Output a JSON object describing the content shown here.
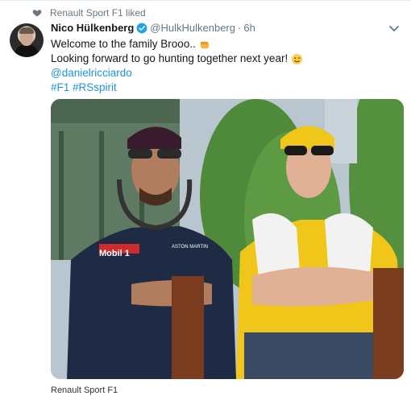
{
  "context": {
    "text": "Renault Sport F1 liked",
    "icon": "heart-icon"
  },
  "author": {
    "name": "Nico Hülkenberg",
    "handle": "@HulkHulkenberg",
    "separator": "·",
    "time": "6h",
    "verified": true
  },
  "tweet": {
    "line1": "Welcome to the family Brooo..",
    "line2": "Looking forward to go hunting together next year!",
    "mention": "@danielricciardo",
    "hashtags": "#F1 #RSspirit"
  },
  "media": {
    "shirt_text_left": "Mobil 1",
    "shirt_text_brand": "ASTON MARTIN"
  },
  "footer": {
    "text": "Renault Sport F1"
  },
  "colors": {
    "link": "#1b95e0",
    "verified": "#1da1f2",
    "secondary_text": "#657786"
  }
}
